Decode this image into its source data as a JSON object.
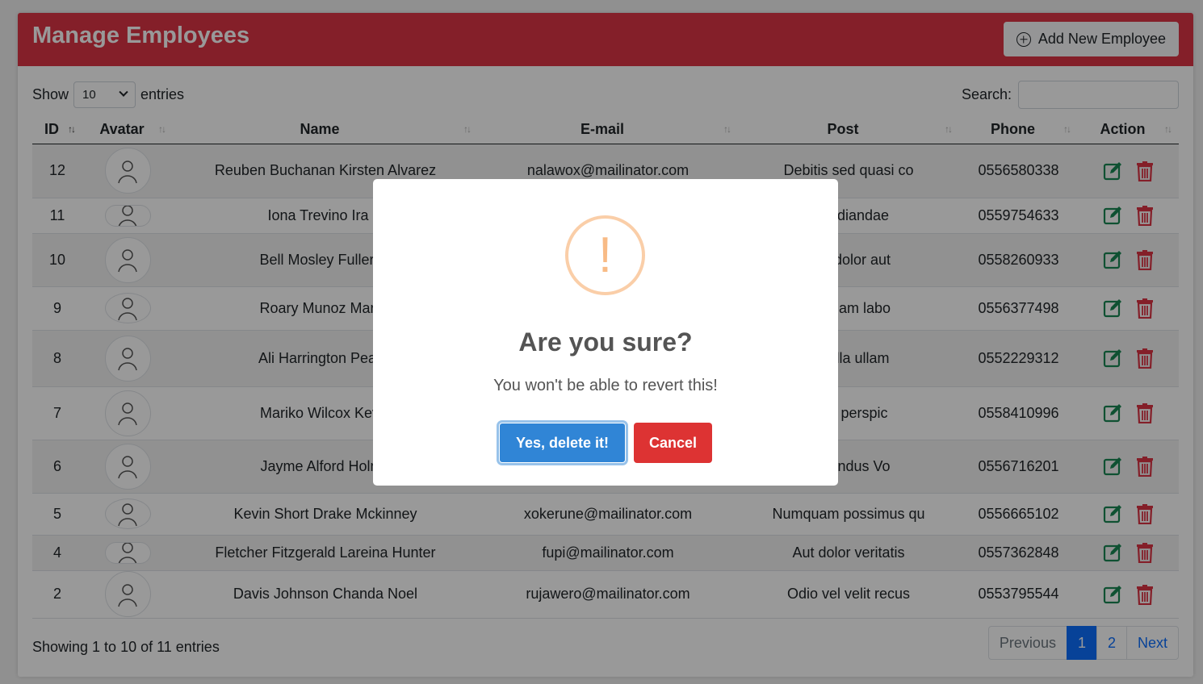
{
  "header": {
    "title": "Manage Employees",
    "add_button_label": "Add New Employee"
  },
  "controls": {
    "show_label": "Show",
    "entries_value": "10",
    "entries_label": "entries",
    "search_label": "Search:",
    "search_value": ""
  },
  "table": {
    "columns": [
      "ID",
      "Avatar",
      "Name",
      "E-mail",
      "Post",
      "Phone",
      "Action"
    ],
    "rows": [
      {
        "id": "12",
        "name": "Reuben Buchanan Kirsten Alvarez",
        "email": "nalawox@mailinator.com",
        "post": "Debitis sed quasi co",
        "phone": "0556580338"
      },
      {
        "id": "11",
        "name": "Iona Trevino Ira C",
        "email": "",
        "post": "repudiandae",
        "phone": "0559754633"
      },
      {
        "id": "10",
        "name": "Bell Mosley Fuller Si",
        "email": "",
        "post": "iam dolor aut",
        "phone": "0558260933"
      },
      {
        "id": "9",
        "name": "Roary Munoz Marah",
        "email": "",
        "post": "aperiam labo",
        "phone": "0556377498"
      },
      {
        "id": "8",
        "name": "Ali Harrington Pearl I",
        "email": "",
        "post": "n nulla ullam",
        "phone": "0552229312"
      },
      {
        "id": "7",
        "name": "Mariko Wilcox Kevin",
        "email": "",
        "post": "quia perspic",
        "phone": "0558410996"
      },
      {
        "id": "6",
        "name": "Jayme Alford Holme",
        "email": "",
        "post": "pellendus Vo",
        "phone": "0556716201"
      },
      {
        "id": "5",
        "name": "Kevin Short Drake Mckinney",
        "email": "xokerune@mailinator.com",
        "post": "Numquam possimus qu",
        "phone": "0556665102"
      },
      {
        "id": "4",
        "name": "Fletcher Fitzgerald Lareina Hunter",
        "email": "fupi@mailinator.com",
        "post": "Aut dolor veritatis",
        "phone": "0557362848"
      },
      {
        "id": "2",
        "name": "Davis Johnson Chanda Noel",
        "email": "rujawero@mailinator.com",
        "post": "Odio vel velit recus",
        "phone": "0553795544"
      }
    ]
  },
  "footer": {
    "info": "Showing 1 to 10 of 11 entries",
    "previous": "Previous",
    "pages": [
      "1",
      "2"
    ],
    "next": "Next"
  },
  "modal": {
    "icon_glyph": "!",
    "title": "Are you sure?",
    "text": "You won't be able to revert this!",
    "confirm_label": "Yes, delete it!",
    "cancel_label": "Cancel"
  },
  "colors": {
    "header": "#dc3545",
    "confirm": "#3085d6",
    "cancel": "#dd3333",
    "edit": "#198754",
    "delete": "#dc3545",
    "warning": "#f8bb86"
  }
}
